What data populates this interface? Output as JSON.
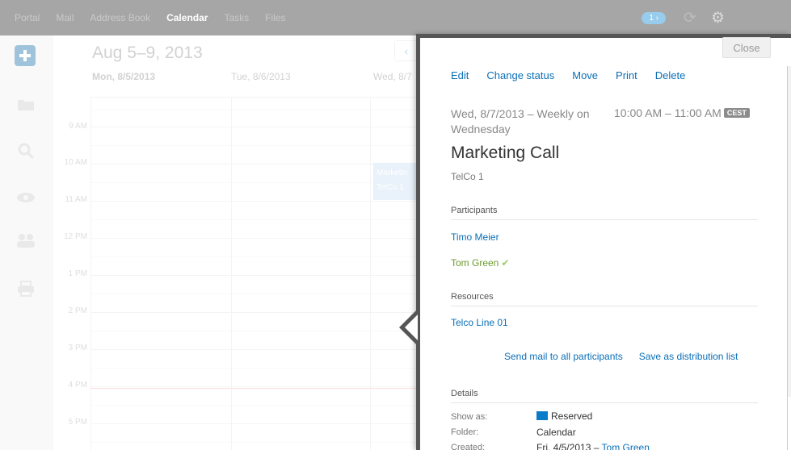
{
  "topnav": {
    "items": [
      "Portal",
      "Mail",
      "Address Book",
      "Calendar",
      "Tasks",
      "Files"
    ],
    "active_index": 3,
    "badge": "1 ›",
    "refresh_icon": "refresh-icon",
    "settings_icon": "gear-icon"
  },
  "sidebar": {
    "icons": [
      "plus-icon",
      "folder-icon",
      "search-icon",
      "eye-icon",
      "people-icon",
      "print-icon"
    ]
  },
  "calendar": {
    "title": "Aug 5–9, 2013",
    "days": [
      "Mon, 8/5/2013",
      "Tue, 8/6/2013",
      "Wed, 8/7"
    ],
    "times": [
      "9 AM",
      "10 AM",
      "11 AM",
      "12 PM",
      "1 PM",
      "2 PM",
      "3 PM",
      "4 PM",
      "5 PM"
    ],
    "event_title": "Marketin",
    "event_sub": "TelCo 1"
  },
  "popup": {
    "close": "Close",
    "actions": [
      "Edit",
      "Change status",
      "Move",
      "Print",
      "Delete"
    ],
    "date": "Wed, 8/7/2013 – Weekly on Wednesday",
    "time": "10:00 AM – 11:00 AM",
    "tz": "CEST",
    "title": "Marketing Call",
    "location": "TelCo 1",
    "participants_label": "Participants",
    "participants": [
      "Timo Meier",
      "Tom Green"
    ],
    "resources_label": "Resources",
    "resource": "Telco Line 01",
    "send_mail": "Send mail to all participants",
    "save_list": "Save as distribution list",
    "details_label": "Details",
    "show_as_label": "Show as:",
    "show_as_value": "Reserved",
    "folder_label": "Folder:",
    "folder_value": "Calendar",
    "created_label": "Created:",
    "created_value": "Fri, 4/5/2013 –",
    "created_by": "Tom Green",
    "colors": {
      "link": "#0a6fb7",
      "reserved": "#0a7bc8",
      "accepted": "#6b9a2c"
    }
  }
}
